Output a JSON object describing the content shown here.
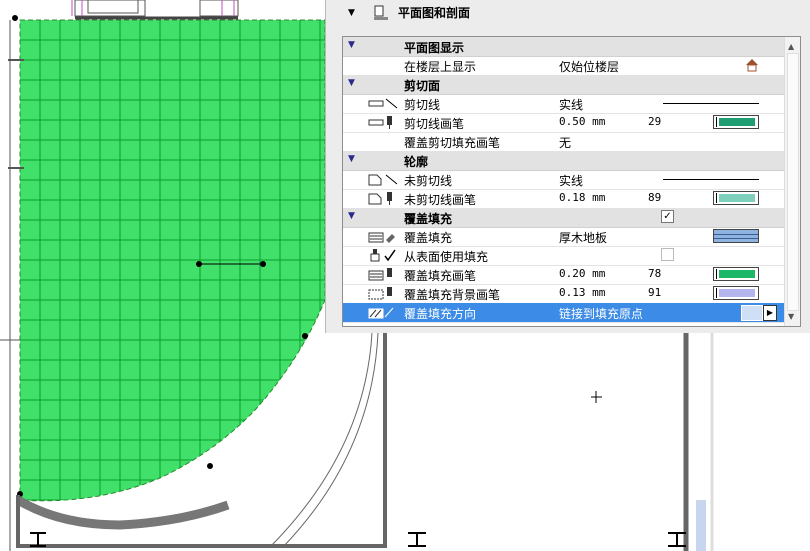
{
  "panel": {
    "title": "平面图和剖面",
    "icon": "floor-plan-section-icon"
  },
  "rows": [
    {
      "type": "section",
      "label": "平面图显示"
    },
    {
      "type": "item",
      "label": "在楼层上显示",
      "value": "仅始位楼层",
      "icon": "",
      "extra": "house-icon"
    },
    {
      "type": "section",
      "label": "剪切面"
    },
    {
      "type": "item",
      "label": "剪切线",
      "value": "实线",
      "icon": "cut-line-icon",
      "extra": "line-preview"
    },
    {
      "type": "item",
      "label": "剪切线画笔",
      "value": "0.50 mm",
      "number": "29",
      "icon": "pen-icon",
      "extra": "pen-swatch",
      "color": "#1e9e72"
    },
    {
      "type": "item",
      "label": "覆盖剪切填充画笔",
      "value": "无",
      "icon": ""
    },
    {
      "type": "section",
      "label": "轮廓"
    },
    {
      "type": "item",
      "label": "未剪切线",
      "value": "实线",
      "icon": "uncut-line-icon",
      "extra": "line-preview"
    },
    {
      "type": "item",
      "label": "未剪切线画笔",
      "value": "0.18 mm",
      "number": "89",
      "icon": "uncut-pen-icon",
      "extra": "pen-swatch",
      "color": "#7ed0bd"
    },
    {
      "type": "section",
      "label": "覆盖填充",
      "checked": true
    },
    {
      "type": "item",
      "label": "覆盖填充",
      "value": "厚木地板",
      "icon": "fill-type-icon",
      "extra": "fill-swatch",
      "color": "#8fb3e0"
    },
    {
      "type": "item",
      "label": "从表面使用填充",
      "value": "",
      "icon": "surface-check-icon",
      "extra": "checkbox-disabled"
    },
    {
      "type": "item",
      "label": "覆盖填充画笔",
      "value": "0.20 mm",
      "number": "78",
      "icon": "fill-pen-icon",
      "extra": "pen-swatch",
      "color": "#1db867"
    },
    {
      "type": "item",
      "label": "覆盖填充背景画笔",
      "value": "0.13 mm",
      "number": "91",
      "icon": "fill-bg-pen-icon",
      "extra": "pen-swatch",
      "color": "#b4b4ee"
    },
    {
      "type": "item",
      "label": "覆盖填充方向",
      "value": "链接到填充原点",
      "icon": "fill-orientation-icon",
      "extra": "orientation-buttons",
      "selected": true
    }
  ],
  "colors": {
    "fill_green": "#40e06a",
    "grid_line": "#0aa02a",
    "selection": "#3c8be6",
    "wall": "#777777"
  }
}
